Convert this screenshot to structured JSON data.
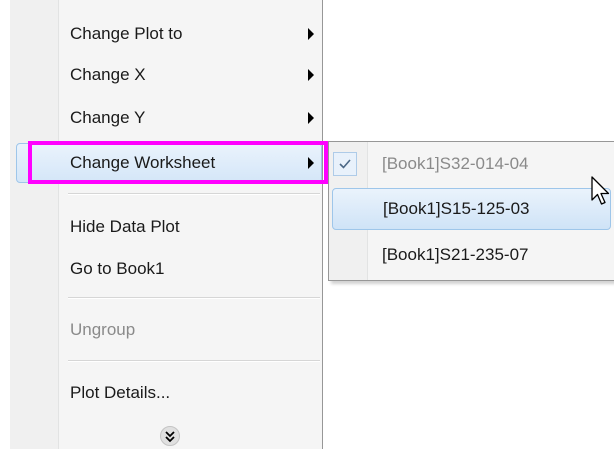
{
  "menu": {
    "items": [
      {
        "label": "Change Plot to",
        "submenu": true,
        "disabled": false
      },
      {
        "label": "Change X",
        "submenu": true,
        "disabled": false
      },
      {
        "label": "Change Y",
        "submenu": true,
        "disabled": false
      },
      {
        "label": "Change Worksheet",
        "submenu": true,
        "disabled": false,
        "highlighted": true
      },
      {
        "label": "Hide Data Plot",
        "submenu": false,
        "disabled": false
      },
      {
        "label": "Go to Book1",
        "submenu": false,
        "disabled": false
      },
      {
        "label": "Ungroup",
        "submenu": false,
        "disabled": true
      },
      {
        "label": "Plot Details...",
        "submenu": false,
        "disabled": false
      }
    ],
    "more_icon": "double-chevron-down-icon"
  },
  "submenu": {
    "items": [
      {
        "label": "[Book1]S32-014-04",
        "checked": true
      },
      {
        "label": "[Book1]S15-125-03",
        "hovered": true
      },
      {
        "label": "[Book1]S21-235-07"
      }
    ]
  },
  "colors": {
    "highlight_outline": "#ff00ff",
    "hover_border": "#9ec6ea",
    "hover_fill": "#d4e6f8"
  }
}
